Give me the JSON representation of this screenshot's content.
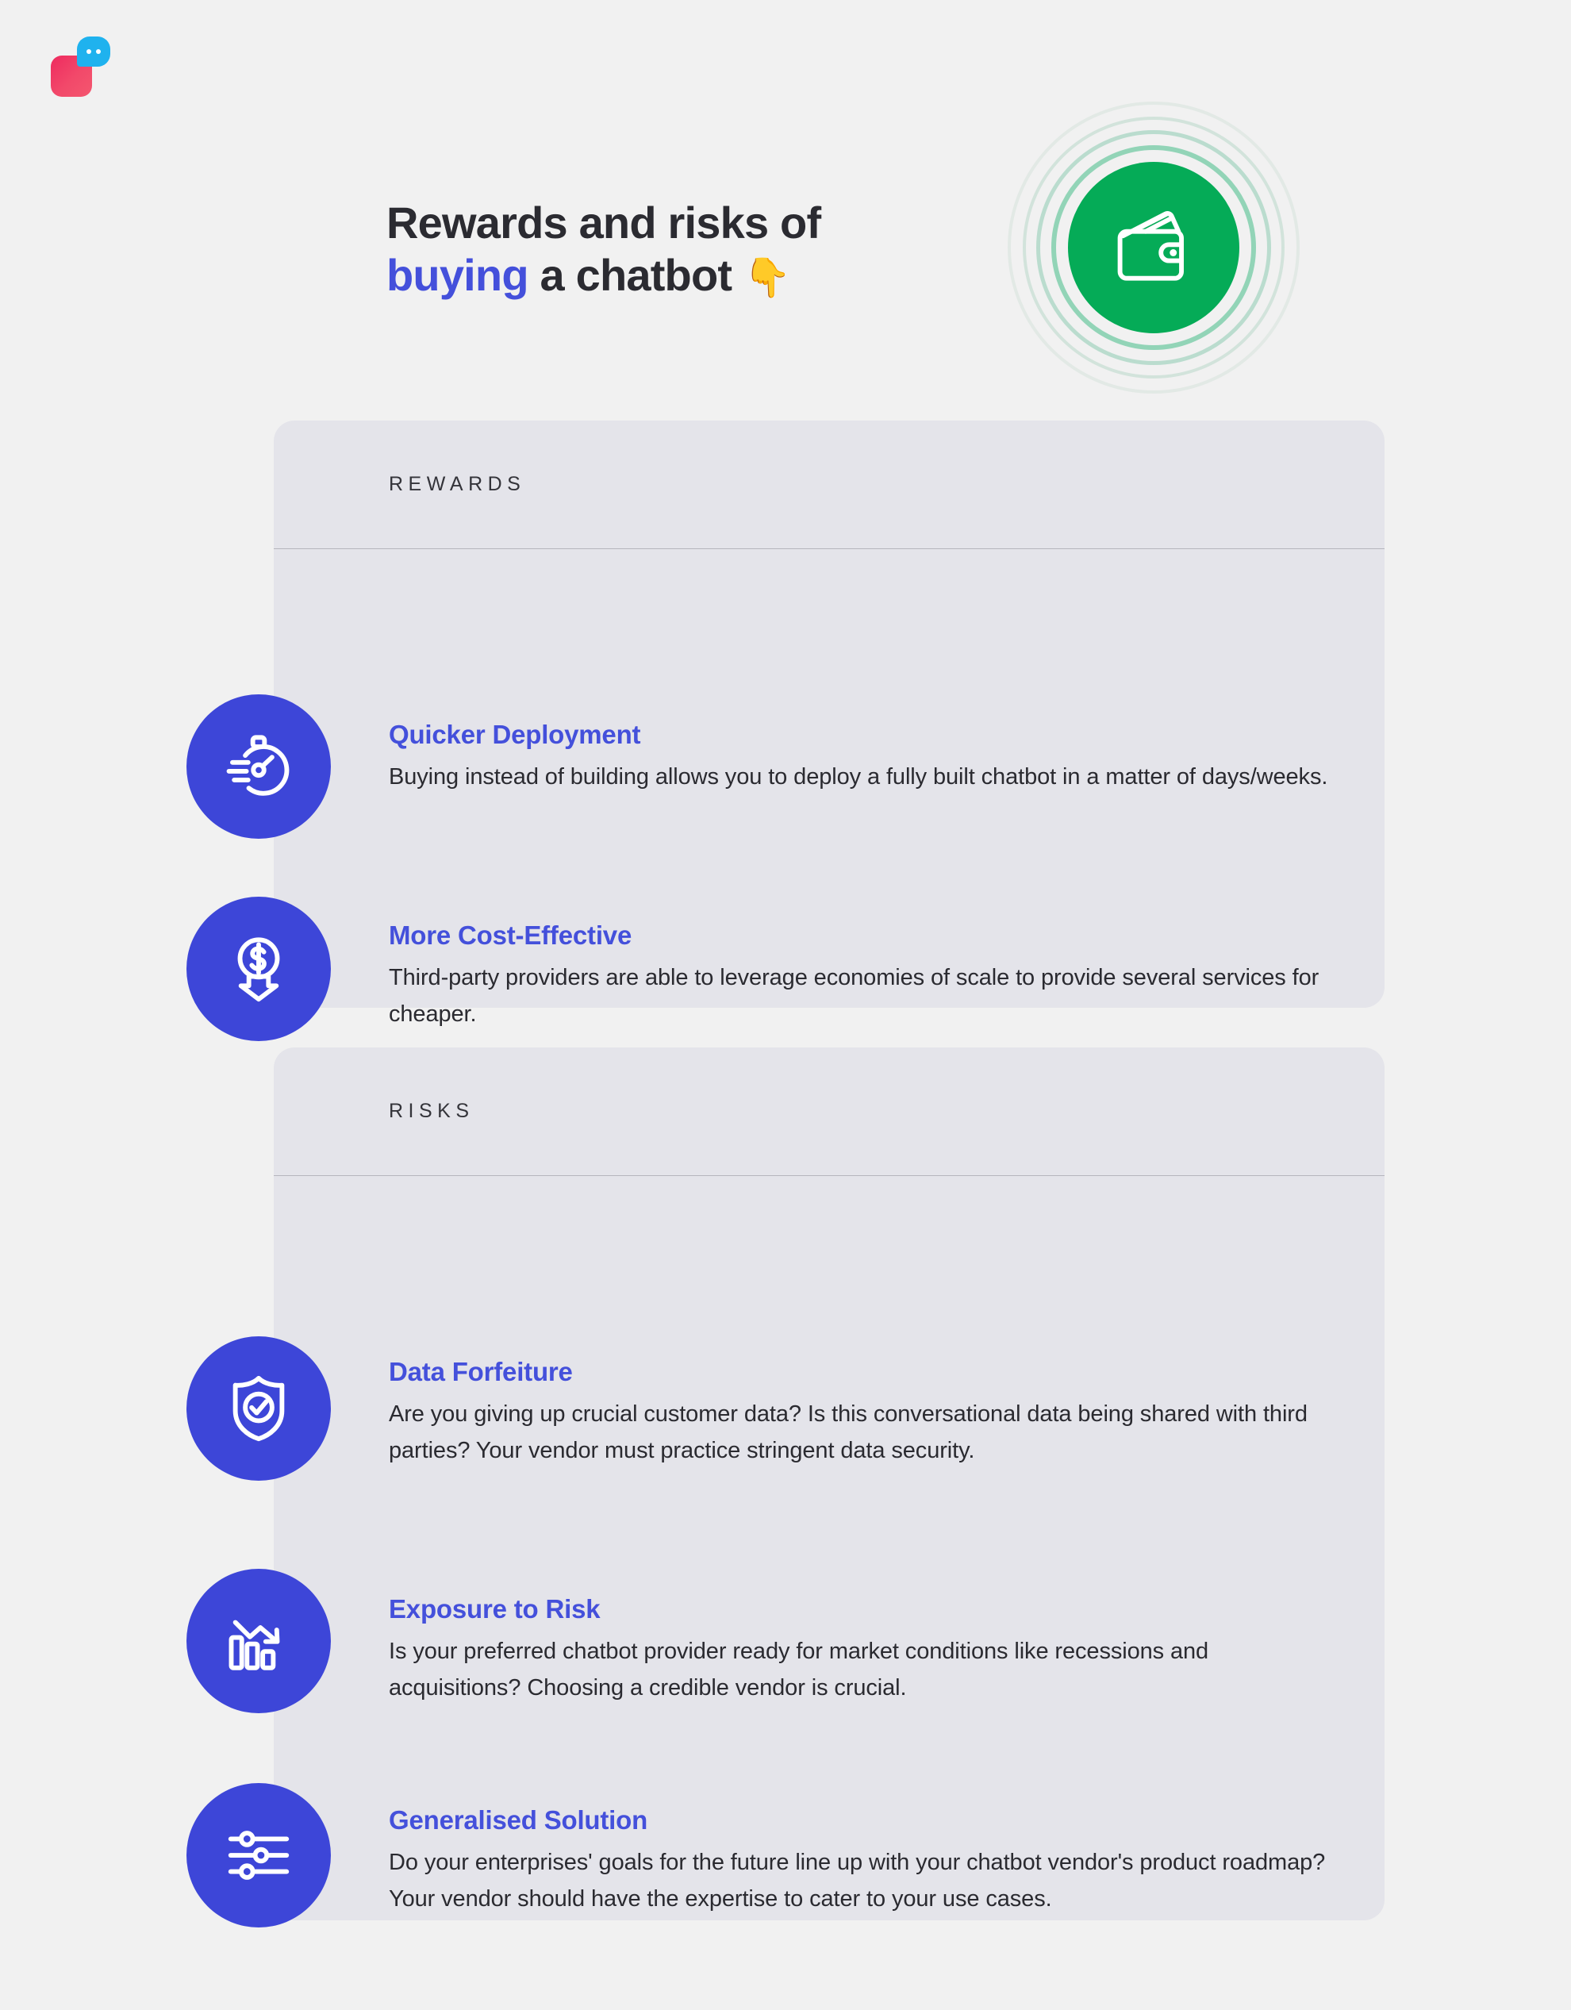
{
  "brand": {
    "logo_name": "chatbot-logo",
    "square_color": "#f2496a",
    "bubble_color": "#1fb2ee"
  },
  "header": {
    "title_line1": "Rewards and risks of",
    "title_accent": "buying",
    "title_rest": " a chatbot ",
    "title_emoji": "👇",
    "accent_color": "#4450db",
    "badge": {
      "icon_name": "wallet-icon",
      "color": "#05ab57",
      "ripple_color": "#6ac79e"
    }
  },
  "sections": [
    {
      "id": "rewards",
      "title": "REWARDS",
      "items": [
        {
          "icon_name": "stopwatch-speed-icon",
          "title": "Quicker Deployment",
          "desc": "Buying instead of building allows you to deploy a fully built chatbot in a matter of days/weeks."
        },
        {
          "icon_name": "dollar-down-arrow-icon",
          "title": "More Cost-Effective",
          "desc": "Third-party providers are able to leverage economies of scale to provide several services for cheaper."
        }
      ]
    },
    {
      "id": "risks",
      "title": "RISKS",
      "items": [
        {
          "icon_name": "shield-check-icon",
          "title": "Data Forfeiture",
          "desc": "Are you giving up crucial customer data? Is this conversational data being shared with third parties? Your vendor must practice stringent data security."
        },
        {
          "icon_name": "declining-bar-chart-icon",
          "title": "Exposure to Risk",
          "desc": "Is your preferred chatbot provider ready for market conditions like recessions and acquisitions? Choosing a credible vendor is crucial."
        },
        {
          "icon_name": "sliders-settings-icon",
          "title": "Generalised Solution",
          "desc": "Do your enterprises' goals for the future line up with your chatbot vendor's product roadmap? Your vendor should have the expertise to cater to your use cases."
        }
      ]
    }
  ],
  "theme": {
    "page_bg": "#f1f1f1",
    "card_bg": "#e4e4ea",
    "icon_circle": "#3d46d8",
    "body_text": "#2a2a30"
  }
}
